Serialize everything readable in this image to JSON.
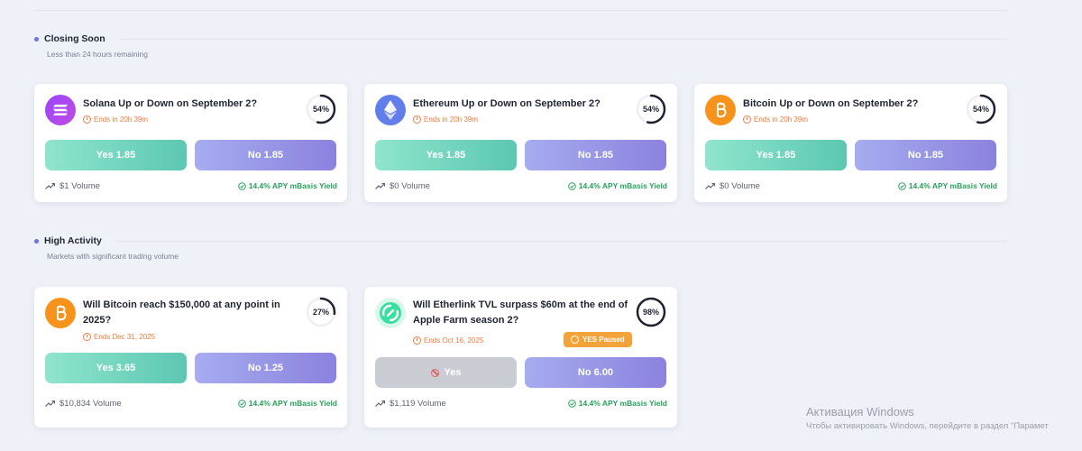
{
  "sections": {
    "closing_soon": {
      "title": "Closing Soon",
      "subtitle": "Less than 24 hours remaining"
    },
    "high_activity": {
      "title": "High Activity",
      "subtitle": "Markets with significant trading volume"
    }
  },
  "markets": [
    {
      "icon": "solana-icon",
      "title": "Solana Up or Down on September 2?",
      "ends": "Ends in 20h 39m",
      "probability": 54,
      "probability_label": "54%",
      "yes_label": "Yes 1.85",
      "no_label": "No 1.85",
      "volume": "$1 Volume",
      "yield": "14.4% APY mBasis Yield"
    },
    {
      "icon": "ethereum-icon",
      "title": "Ethereum Up or Down on September 2?",
      "ends": "Ends in 20h 39m",
      "probability": 54,
      "probability_label": "54%",
      "yes_label": "Yes 1.85",
      "no_label": "No 1.85",
      "volume": "$0 Volume",
      "yield": "14.4% APY mBasis Yield"
    },
    {
      "icon": "bitcoin-icon",
      "title": "Bitcoin Up or Down on September 2?",
      "ends": "Ends in 20h 39m",
      "probability": 54,
      "probability_label": "54%",
      "yes_label": "Yes 1.85",
      "no_label": "No 1.85",
      "volume": "$0 Volume",
      "yield": "14.4% APY mBasis Yield"
    },
    {
      "icon": "bitcoin-icon",
      "title": "Will Bitcoin reach $150,000 at any point in 2025?",
      "ends": "Ends Dec 31, 2025",
      "probability": 27,
      "probability_label": "27%",
      "yes_label": "Yes 3.65",
      "no_label": "No 1.25",
      "volume": "$10,834 Volume",
      "yield": "14.4% APY mBasis Yield"
    },
    {
      "icon": "etherlink-icon",
      "title": "Will Etherlink TVL surpass $60m at the end of Apple Farm season 2?",
      "ends": "Ends Oct 16, 2025",
      "probability": 98,
      "probability_label": "98%",
      "badge": "YES Paused",
      "yes_label": "Yes",
      "no_label": "No 6.00",
      "volume": "$1,119 Volume",
      "yield": "14.4% APY mBasis Yield"
    }
  ],
  "colors": {
    "background": "#eef1f7",
    "yes_gradient": "#5cc7b2",
    "no_gradient": "#8b82de",
    "ends_text": "#f07a3a",
    "yield_text": "#27a05a",
    "paused_badge": "#f2a33a"
  },
  "watermark": {
    "title": "Активация Windows",
    "subtitle": "Чтобы активировать Windows, перейдите в раздел \"Парамет"
  }
}
